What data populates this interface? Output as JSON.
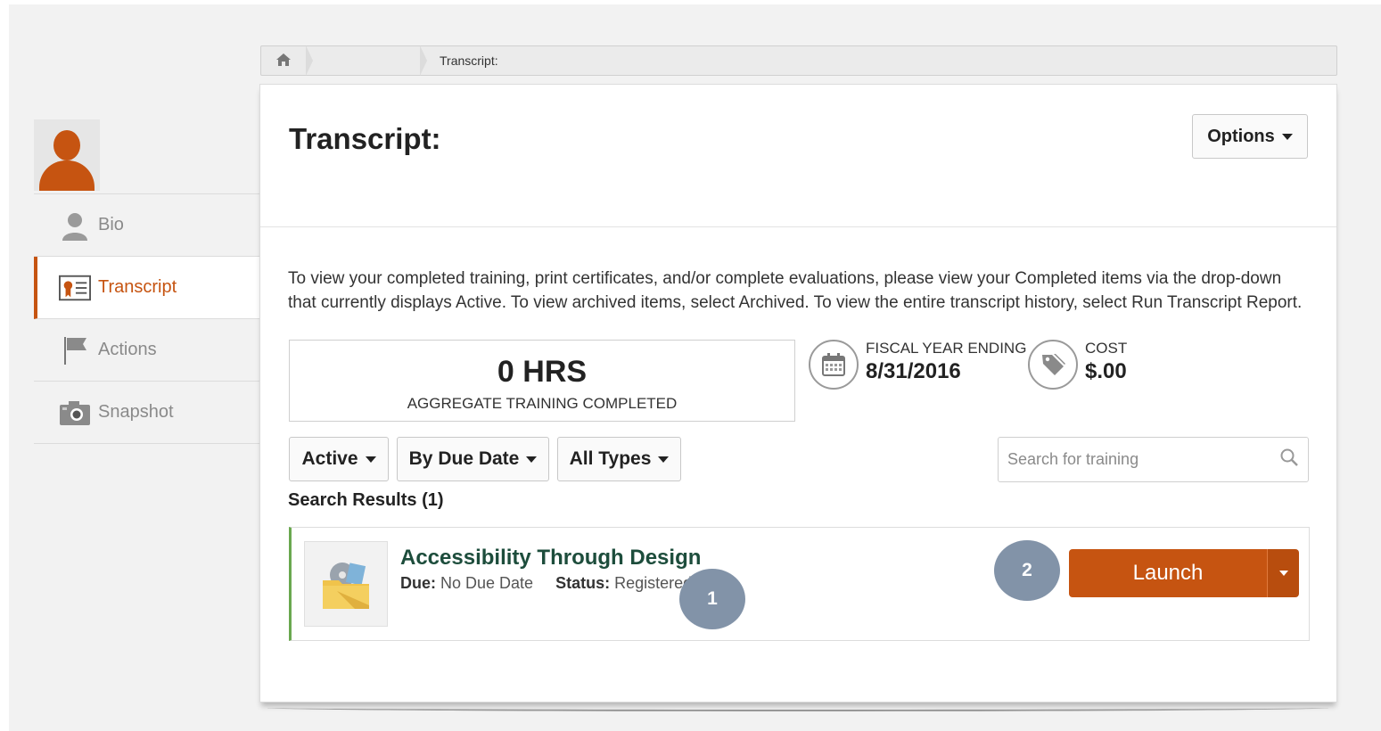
{
  "breadcrumb": {
    "home_icon": "home-icon",
    "current": "Transcript:"
  },
  "sidebar": {
    "avatar_icon": "user-avatar-icon",
    "items": [
      {
        "label": "Bio",
        "icon": "person-icon",
        "active": false
      },
      {
        "label": "Transcript",
        "icon": "transcript-certificate-icon",
        "active": true
      },
      {
        "label": "Actions",
        "icon": "flag-icon",
        "active": false
      },
      {
        "label": "Snapshot",
        "icon": "camera-icon",
        "active": false
      }
    ]
  },
  "main": {
    "title": "Transcript:",
    "options_label": "Options",
    "intro": "To view your completed training, print certificates, and/or complete evaluations, please view your Completed items via the drop-down that currently displays Active. To view archived items, select Archived. To view the entire transcript history, select Run Transcript Report.",
    "hours": {
      "value": "0 HRS",
      "label": "AGGREGATE TRAINING COMPLETED"
    },
    "fiscal": {
      "label": "FISCAL YEAR ENDING",
      "value": "8/31/2016",
      "icon": "calendar-icon"
    },
    "cost": {
      "label": "COST",
      "value": "$.00",
      "icon": "price-tag-icon"
    },
    "filters": {
      "status": "Active",
      "sort": "By Due Date",
      "type": "All Types"
    },
    "search": {
      "placeholder": "Search for training",
      "icon": "search-icon"
    },
    "results_label": "Search Results (1)",
    "result": {
      "title": "Accessibility Through Design",
      "due_label": "Due:",
      "due_value": "No Due Date",
      "status_label": "Status:",
      "status_value": "Registered",
      "thumb_icon": "course-folder-icon",
      "launch_label": "Launch"
    },
    "callouts": [
      "1",
      "2"
    ]
  },
  "colors": {
    "accent": "#c65411",
    "title_green": "#1d4d3c",
    "callout": "#8293a8",
    "row_border": "#6aa84f"
  }
}
